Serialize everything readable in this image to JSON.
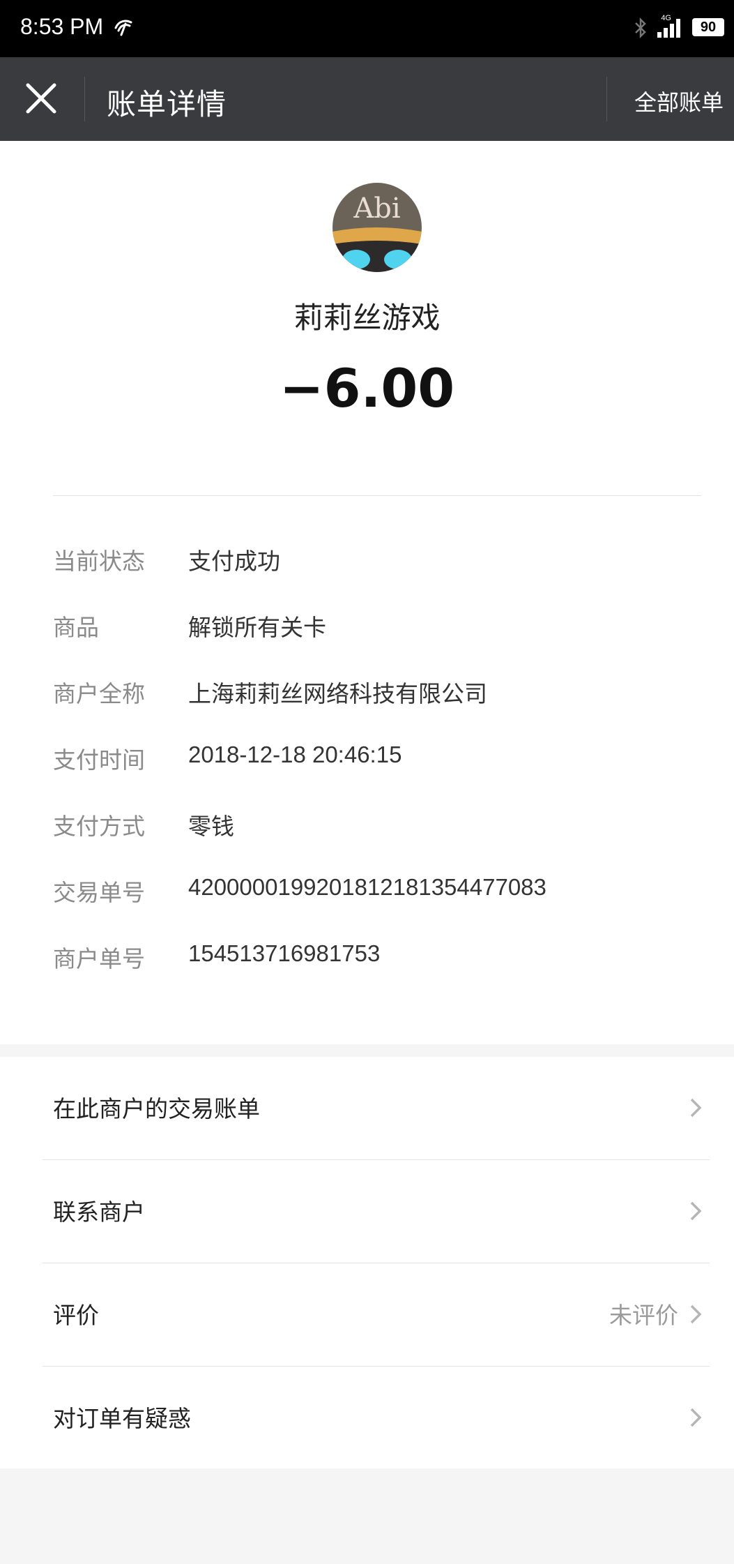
{
  "status_bar": {
    "time": "8:53 PM",
    "network": "4G",
    "battery": "90"
  },
  "title_bar": {
    "title": "账单详情",
    "right_link": "全部账单"
  },
  "merchant": {
    "avatar_text": "Abi",
    "name": "莉莉丝游戏",
    "amount": "−6.00"
  },
  "details": [
    {
      "label": "当前状态",
      "value": "支付成功"
    },
    {
      "label": "商品",
      "value": "解锁所有关卡"
    },
    {
      "label": "商户全称",
      "value": "上海莉莉丝网络科技有限公司"
    },
    {
      "label": "支付时间",
      "value": "2018-12-18 20:46:15"
    },
    {
      "label": "支付方式",
      "value": "零钱"
    },
    {
      "label": "交易单号",
      "value": "4200000199201812181354477083"
    },
    {
      "label": "商户单号",
      "value": "154513716981753"
    }
  ],
  "menu": [
    {
      "label": "在此商户的交易账单",
      "value": ""
    },
    {
      "label": "联系商户",
      "value": ""
    },
    {
      "label": "评价",
      "value": "未评价"
    },
    {
      "label": "对订单有疑惑",
      "value": ""
    }
  ],
  "colors": {
    "title_bar_bg": "#3a3b3f",
    "status_bar_bg": "#000000",
    "page_bg": "#f5f5f5"
  }
}
